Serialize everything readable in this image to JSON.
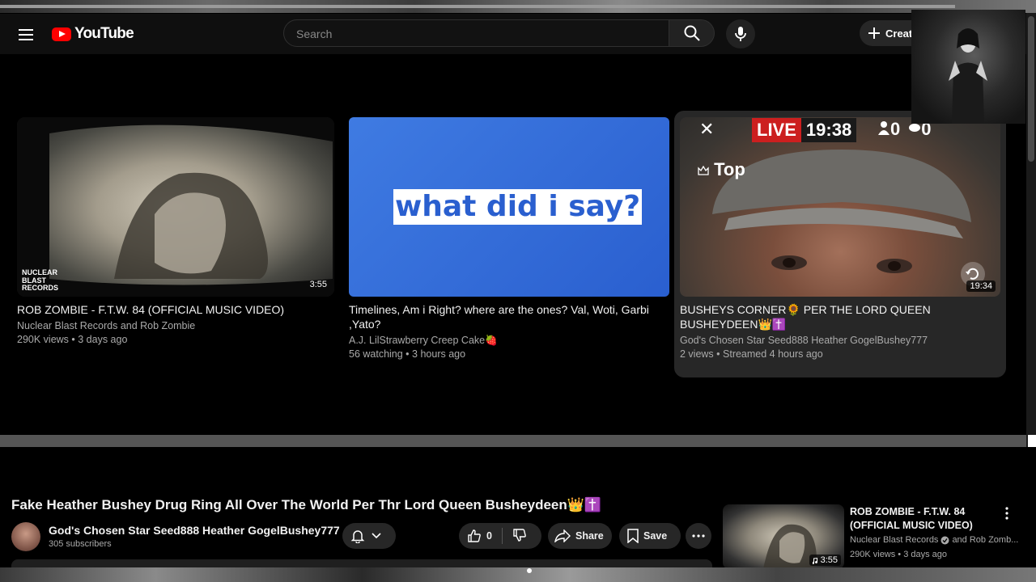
{
  "header": {
    "brand": "YouTube",
    "search_placeholder": "Search",
    "create_label": "Creat"
  },
  "feed": [
    {
      "title": "ROB ZOMBIE - F.T.W. 84 (OFFICIAL MUSIC VIDEO)",
      "channel": "Nuclear Blast Records and Rob Zombie",
      "meta": "290K views • 3 days ago",
      "duration": "3:55",
      "thumb_label": "NUCLEAR\nBLAST\nRECORDS"
    },
    {
      "title": "Timelines, Am i Right? where are the ones? Val, Woti, Garbi ,Yato?",
      "channel": "A.J. LilStrawberry Creep Cake🍓",
      "meta": "56 watching • 3 hours ago",
      "thumb_caption": "what did i say?"
    },
    {
      "title": "BUSHEYS CORNER🌻 PER THE LORD QUEEN BUSHEYDEEN👑✝️",
      "channel": "God's Chosen Star Seed888 Heather GogelBushey777",
      "meta": "2 views • Streamed 4 hours ago",
      "duration": "19:34",
      "live_label": "LIVE",
      "live_time": "19:38",
      "viewers": "0",
      "likes": "0",
      "top_label": "Top",
      "close_symbol": "✕"
    }
  ],
  "video": {
    "title": "Fake Heather Bushey Drug Ring All Over The World Per Thr Lord Queen Busheydeen👑✝️",
    "channel": "God's Chosen Star Seed888 Heather GogelBushey777",
    "subscribers": "305 subscribers",
    "likes": "0",
    "share_label": "Share",
    "save_label": "Save"
  },
  "recommended": {
    "title": "ROB ZOMBIE - F.T.W. 84 (OFFICIAL MUSIC VIDEO)",
    "channel": "Nuclear Blast Records",
    "channel_suffix": "and Rob Zomb...",
    "meta": "290K views • 3 days ago",
    "duration": "3:55"
  },
  "colors": {
    "brand_red": "#ff0000",
    "live_red": "#cc1f1f",
    "thumb_blue": "#2a5fcf"
  }
}
